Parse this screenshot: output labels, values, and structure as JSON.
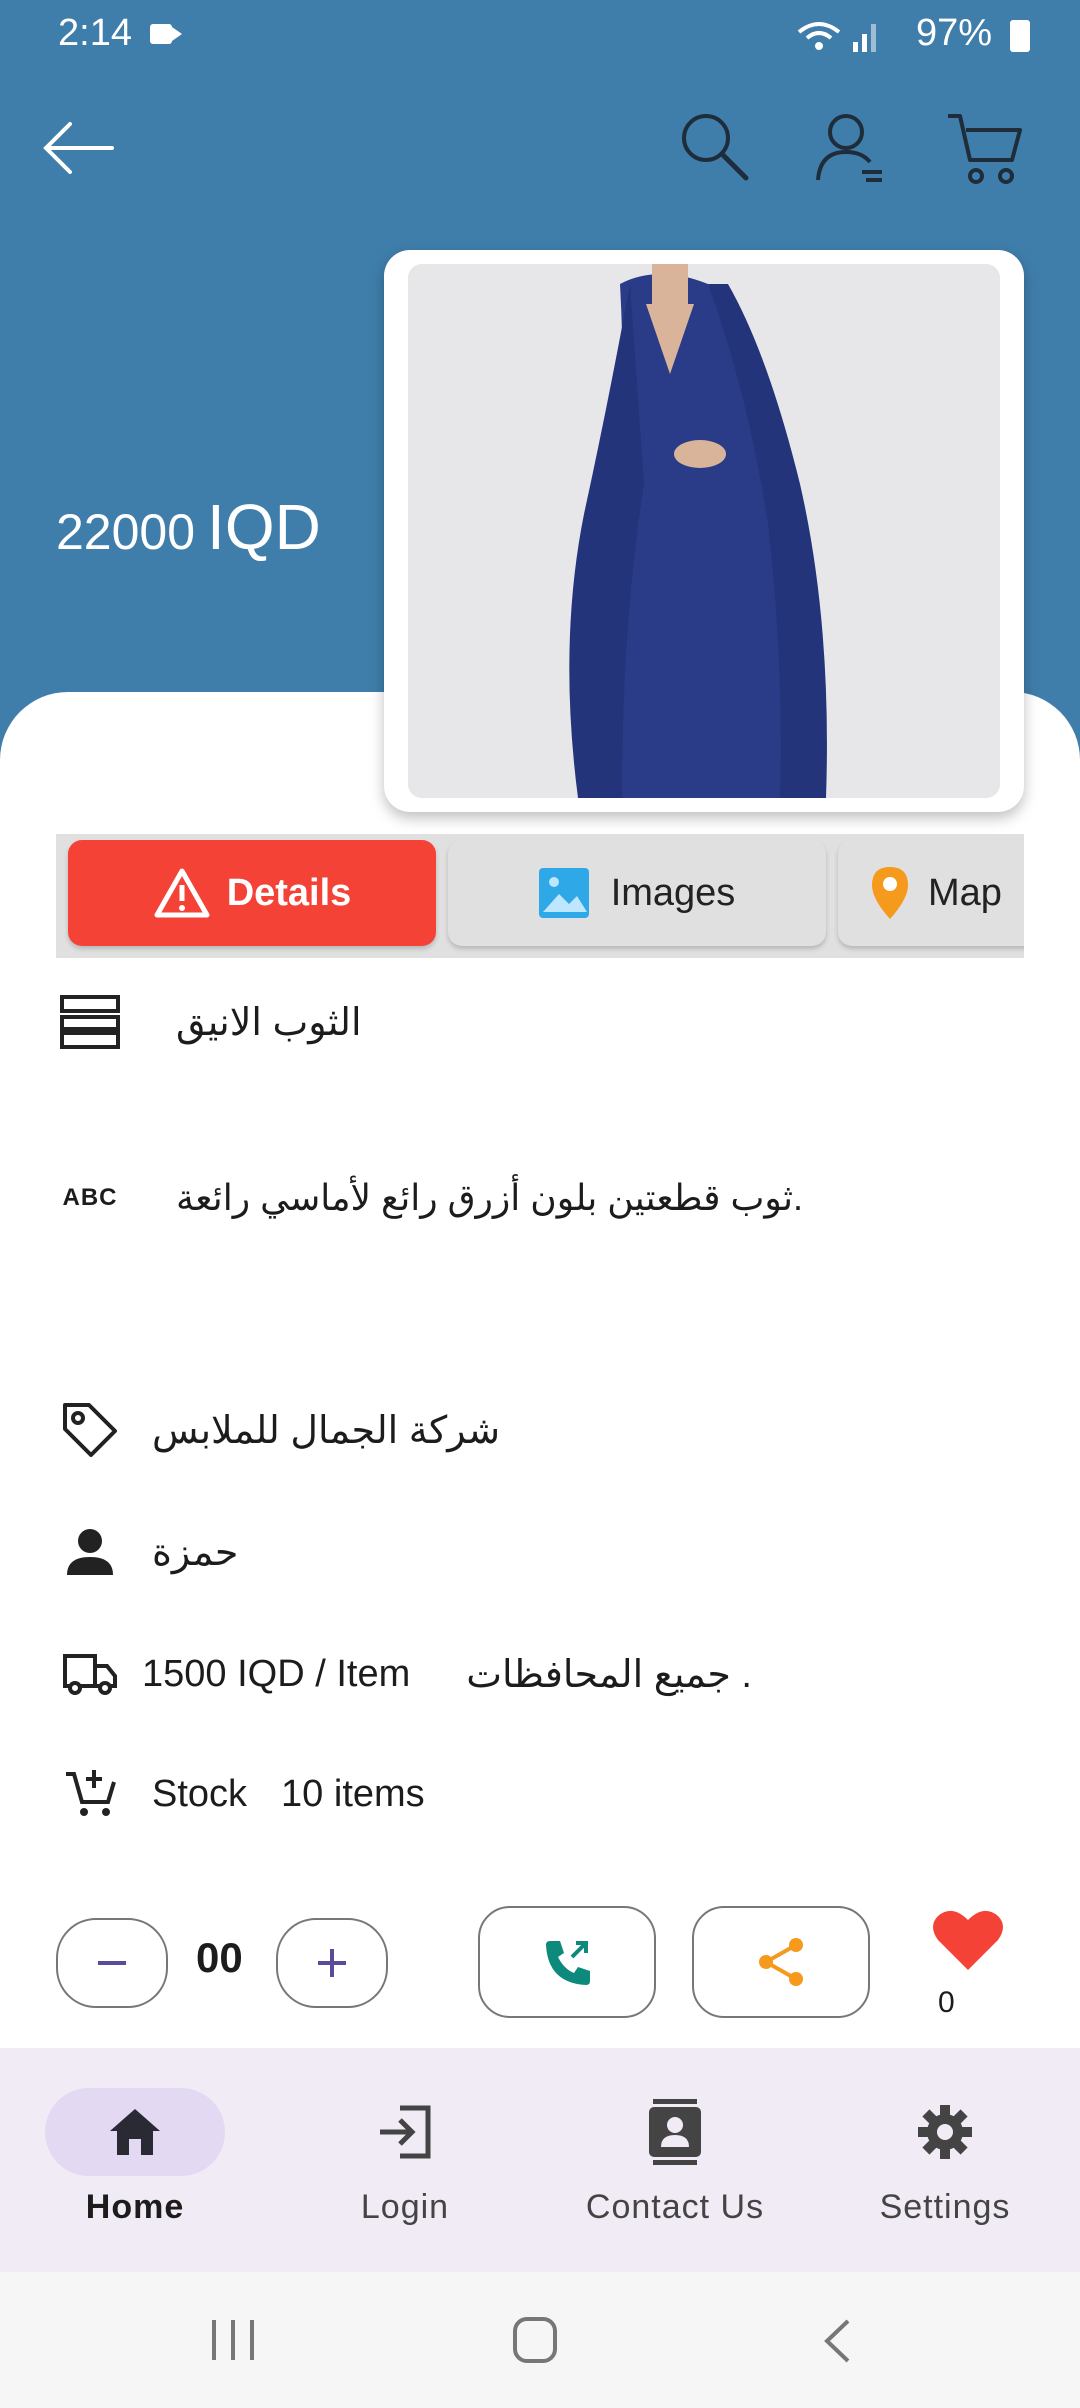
{
  "status_bar": {
    "time": "2:14",
    "battery": "97%"
  },
  "header": {
    "icons": [
      "back-arrow-icon",
      "search-icon",
      "account-icon",
      "cart-icon"
    ]
  },
  "product": {
    "price_amount": "22000",
    "price_currency": "IQD",
    "name": "الثوب الانيق",
    "description": "ثوب قطعتين بلون أزرق رائع لأماسي رائعة.",
    "company": "شركة الجمال للملابس",
    "seller": "حمزة",
    "shipping_price": "1500 IQD / Item",
    "shipping_area": "جميع المحافظات .",
    "stock_label": "Stock",
    "stock_value": "10 items"
  },
  "tabs": [
    {
      "label": "Details",
      "active": true
    },
    {
      "label": "Images",
      "active": false
    },
    {
      "label": "Map",
      "active": false
    }
  ],
  "actions": {
    "quantity": "00",
    "likes": "0"
  },
  "bottom_nav": [
    {
      "label": "Home",
      "active": true
    },
    {
      "label": "Login",
      "active": false
    },
    {
      "label": "Contact Us",
      "active": false
    },
    {
      "label": "Settings",
      "active": false
    }
  ],
  "colors": {
    "header": "#3f7daa",
    "tab_active": "#f44336",
    "heart": "#f44336",
    "call": "#0d8a7c",
    "share": "#f59a1c",
    "nav_bg": "#f1ebf6"
  }
}
